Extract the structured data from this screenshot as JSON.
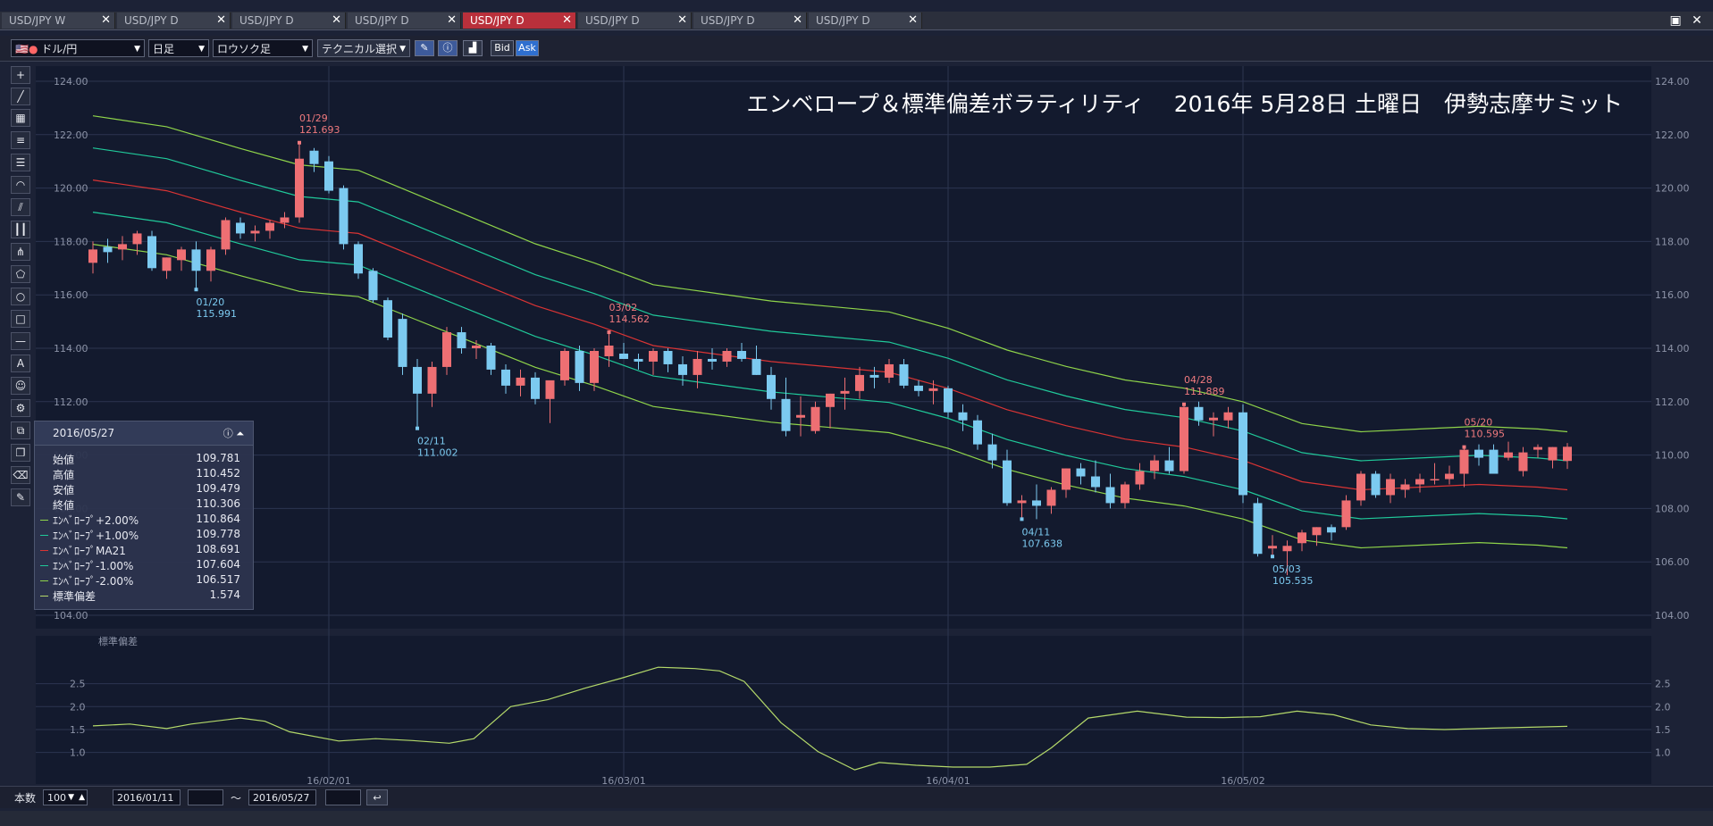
{
  "tabs": [
    {
      "label": "USD/JPY W",
      "active": false
    },
    {
      "label": "USD/JPY D",
      "active": false
    },
    {
      "label": "USD/JPY D",
      "active": false
    },
    {
      "label": "USD/JPY D",
      "active": false
    },
    {
      "label": "USD/JPY D",
      "active": true
    },
    {
      "label": "USD/JPY D",
      "active": false
    },
    {
      "label": "USD/JPY D",
      "active": false
    },
    {
      "label": "USD/JPY D",
      "active": false
    }
  ],
  "toolbar": {
    "pair": "ドル/円",
    "period": "日足",
    "chart_type": "ロウソク足",
    "technical": "テクニカル選択",
    "bid": "Bid",
    "ask": "Ask"
  },
  "bottom": {
    "count_label": "本数",
    "count_value": "100",
    "from_date": "2016/01/11",
    "tilde": "〜",
    "to_date": "2016/05/27"
  },
  "info": {
    "date": "2016/05/27",
    "rows": [
      {
        "label": "始値",
        "value": "109.781",
        "color": ""
      },
      {
        "label": "高値",
        "value": "110.452",
        "color": ""
      },
      {
        "label": "安値",
        "value": "109.479",
        "color": ""
      },
      {
        "label": "終値",
        "value": "110.306",
        "color": ""
      },
      {
        "label": "ｴﾝﾍﾞﾛｰﾌﾟ+2.00%",
        "value": "110.864",
        "color": "#8fd44a"
      },
      {
        "label": "ｴﾝﾍﾞﾛｰﾌﾟ+1.00%",
        "value": "109.778",
        "color": "#20c99a"
      },
      {
        "label": "ｴﾝﾍﾞﾛｰﾌﾟMA21",
        "value": "108.691",
        "color": "#d93434"
      },
      {
        "label": "ｴﾝﾍﾞﾛｰﾌﾟ-1.00%",
        "value": "107.604",
        "color": "#20c99a"
      },
      {
        "label": "ｴﾝﾍﾞﾛｰﾌﾟ-2.00%",
        "value": "106.517",
        "color": "#8fd44a"
      },
      {
        "label": "標準偏差",
        "value": "1.574",
        "color": "#b4d96a"
      }
    ]
  },
  "chart_data": [
    {
      "type": "candlestick",
      "title": "エンベロープ＆標準偏差ボラティリティ　 2016年 5月28日 土曜日　伊勢志摩サミット",
      "ylim": [
        104,
        124
      ],
      "y_ticks": [
        "124.00",
        "122.00",
        "120.00",
        "118.00",
        "116.00",
        "114.00",
        "112.00",
        "110.00",
        "108.00",
        "106.00",
        "104.00"
      ],
      "x_ticks": [
        {
          "label": "16/02/01",
          "index": 16
        },
        {
          "label": "16/03/01",
          "index": 36
        },
        {
          "label": "16/04/01",
          "index": 58
        },
        {
          "label": "16/05/02",
          "index": 78
        }
      ],
      "colors": {
        "up": "#ee6f73",
        "down": "#7ccaf0",
        "ma": "#d93434",
        "env1": "#20c99a",
        "env2": "#8fd44a"
      },
      "candles": [
        [
          117.2,
          118.0,
          116.8,
          117.7
        ],
        [
          117.8,
          118.1,
          117.2,
          117.6
        ],
        [
          117.7,
          118.2,
          117.3,
          117.9
        ],
        [
          117.9,
          118.4,
          117.5,
          118.3
        ],
        [
          118.2,
          118.4,
          116.9,
          117.0
        ],
        [
          116.9,
          117.4,
          116.6,
          117.4
        ],
        [
          117.3,
          117.8,
          116.9,
          117.7
        ],
        [
          117.7,
          118.0,
          116.2,
          116.9
        ],
        [
          116.9,
          117.8,
          116.5,
          117.7
        ],
        [
          117.7,
          118.9,
          117.5,
          118.8
        ],
        [
          118.7,
          118.9,
          118.1,
          118.3
        ],
        [
          118.3,
          118.6,
          118.0,
          118.4
        ],
        [
          118.4,
          118.8,
          118.1,
          118.7
        ],
        [
          118.7,
          119.1,
          118.5,
          118.9
        ],
        [
          118.9,
          121.7,
          118.7,
          121.1
        ],
        [
          121.4,
          121.5,
          120.6,
          120.9
        ],
        [
          121.0,
          121.2,
          119.8,
          119.9
        ],
        [
          120.0,
          120.1,
          117.7,
          117.9
        ],
        [
          117.9,
          118.0,
          116.6,
          116.8
        ],
        [
          116.9,
          117.0,
          115.7,
          115.8
        ],
        [
          115.8,
          115.9,
          114.3,
          114.4
        ],
        [
          115.1,
          115.3,
          113.0,
          113.3
        ],
        [
          113.3,
          113.6,
          111.0,
          112.3
        ],
        [
          112.3,
          113.5,
          111.8,
          113.3
        ],
        [
          113.3,
          114.8,
          113.0,
          114.6
        ],
        [
          114.6,
          114.8,
          113.8,
          114.0
        ],
        [
          114.0,
          114.3,
          113.6,
          114.1
        ],
        [
          114.1,
          114.2,
          113.0,
          113.2
        ],
        [
          113.2,
          113.4,
          112.3,
          112.6
        ],
        [
          112.6,
          113.2,
          112.2,
          112.9
        ],
        [
          112.9,
          113.1,
          111.9,
          112.1
        ],
        [
          112.1,
          112.6,
          111.2,
          112.8
        ],
        [
          112.8,
          114.0,
          112.6,
          113.9
        ],
        [
          113.9,
          114.1,
          112.4,
          112.7
        ],
        [
          112.7,
          114.0,
          112.4,
          113.9
        ],
        [
          113.7,
          114.6,
          113.3,
          114.1
        ],
        [
          113.8,
          114.2,
          113.6,
          113.6
        ],
        [
          113.6,
          113.8,
          113.2,
          113.5
        ],
        [
          113.5,
          114.0,
          113.0,
          113.9
        ],
        [
          113.9,
          114.0,
          113.1,
          113.4
        ],
        [
          113.4,
          113.7,
          112.6,
          113.0
        ],
        [
          113.0,
          113.9,
          112.5,
          113.6
        ],
        [
          113.6,
          114.0,
          113.2,
          113.5
        ],
        [
          113.5,
          114.0,
          113.3,
          113.9
        ],
        [
          113.9,
          114.2,
          113.5,
          113.6
        ],
        [
          113.6,
          114.1,
          113.0,
          113.0
        ],
        [
          113.0,
          113.3,
          111.7,
          112.1
        ],
        [
          112.1,
          112.9,
          110.7,
          110.9
        ],
        [
          111.4,
          112.2,
          110.7,
          111.5
        ],
        [
          110.9,
          112.0,
          110.8,
          111.8
        ],
        [
          111.8,
          112.3,
          111.0,
          112.3
        ],
        [
          112.3,
          112.9,
          111.7,
          112.4
        ],
        [
          112.4,
          113.3,
          112.1,
          113.0
        ],
        [
          113.0,
          113.3,
          112.5,
          112.9
        ],
        [
          112.9,
          113.6,
          112.7,
          113.4
        ],
        [
          113.4,
          113.6,
          112.5,
          112.6
        ],
        [
          112.6,
          112.8,
          112.2,
          112.4
        ],
        [
          112.4,
          112.8,
          111.9,
          112.5
        ],
        [
          112.5,
          112.6,
          111.4,
          111.6
        ],
        [
          111.6,
          111.9,
          110.9,
          111.3
        ],
        [
          111.3,
          111.5,
          110.2,
          110.4
        ],
        [
          110.4,
          110.8,
          109.5,
          109.8
        ],
        [
          109.8,
          110.2,
          108.1,
          108.2
        ],
        [
          108.2,
          108.5,
          107.6,
          108.3
        ],
        [
          108.3,
          108.9,
          107.6,
          108.1
        ],
        [
          108.1,
          108.8,
          107.8,
          108.7
        ],
        [
          108.7,
          109.5,
          108.4,
          109.5
        ],
        [
          109.5,
          109.7,
          108.9,
          109.2
        ],
        [
          109.2,
          109.8,
          108.6,
          108.8
        ],
        [
          108.8,
          109.3,
          108.0,
          108.2
        ],
        [
          108.2,
          109.0,
          108.0,
          108.9
        ],
        [
          108.9,
          109.7,
          108.7,
          109.4
        ],
        [
          109.4,
          110.0,
          109.1,
          109.8
        ],
        [
          109.8,
          110.3,
          109.3,
          109.4
        ],
        [
          109.4,
          111.9,
          109.3,
          111.8
        ],
        [
          111.8,
          112.0,
          111.1,
          111.3
        ],
        [
          111.3,
          111.6,
          110.7,
          111.4
        ],
        [
          111.3,
          111.8,
          111.0,
          111.6
        ],
        [
          111.6,
          111.9,
          108.2,
          108.5
        ],
        [
          108.2,
          108.4,
          106.2,
          106.3
        ],
        [
          106.5,
          107.0,
          106.2,
          106.6
        ],
        [
          106.4,
          106.8,
          105.5,
          106.6
        ],
        [
          106.7,
          107.2,
          106.4,
          107.1
        ],
        [
          107.0,
          107.3,
          106.6,
          107.3
        ],
        [
          107.3,
          107.4,
          106.8,
          107.1
        ],
        [
          107.3,
          108.5,
          107.2,
          108.3
        ],
        [
          108.3,
          109.4,
          108.1,
          109.3
        ],
        [
          109.3,
          109.4,
          108.4,
          108.5
        ],
        [
          108.5,
          109.3,
          108.2,
          109.1
        ],
        [
          108.7,
          109.1,
          108.4,
          108.9
        ],
        [
          108.9,
          109.3,
          108.6,
          109.1
        ],
        [
          109.1,
          109.7,
          108.9,
          109.1
        ],
        [
          109.1,
          109.6,
          108.9,
          109.3
        ],
        [
          109.3,
          110.3,
          108.8,
          110.2
        ],
        [
          110.2,
          110.4,
          109.6,
          109.9
        ],
        [
          110.2,
          110.4,
          109.3,
          109.3
        ],
        [
          109.9,
          110.5,
          109.8,
          110.1
        ],
        [
          109.4,
          110.3,
          109.2,
          110.1
        ],
        [
          110.2,
          110.4,
          109.9,
          110.3
        ],
        [
          109.8,
          110.3,
          109.5,
          110.3
        ],
        [
          109.78,
          110.45,
          109.48,
          110.31
        ]
      ],
      "ma21": [
        [
          0,
          120.3
        ],
        [
          5,
          119.9
        ],
        [
          10,
          119.1
        ],
        [
          14,
          118.5
        ],
        [
          18,
          118.3
        ],
        [
          22,
          117.4
        ],
        [
          26,
          116.5
        ],
        [
          30,
          115.6
        ],
        [
          34,
          114.9
        ],
        [
          38,
          114.1
        ],
        [
          42,
          113.8
        ],
        [
          46,
          113.5
        ],
        [
          50,
          113.3
        ],
        [
          54,
          113.1
        ],
        [
          58,
          112.5
        ],
        [
          62,
          111.7
        ],
        [
          66,
          111.1
        ],
        [
          70,
          110.6
        ],
        [
          74,
          110.3
        ],
        [
          78,
          109.8
        ],
        [
          82,
          109.0
        ],
        [
          86,
          108.7
        ],
        [
          90,
          108.8
        ],
        [
          94,
          108.9
        ],
        [
          98,
          108.8
        ],
        [
          100,
          108.7
        ]
      ],
      "env_offsets_pct": [
        -2,
        -1,
        1,
        2
      ],
      "annotations": [
        {
          "date": "01/29",
          "value": "121.693",
          "index": 14,
          "kind": "high"
        },
        {
          "date": "01/20",
          "value": "115.991",
          "index": 7,
          "kind": "low"
        },
        {
          "date": "02/11",
          "value": "111.002",
          "index": 22,
          "kind": "low"
        },
        {
          "date": "03/02",
          "value": "114.562",
          "index": 35,
          "kind": "high"
        },
        {
          "date": "04/11",
          "value": "107.638",
          "index": 63,
          "kind": "low"
        },
        {
          "date": "04/28",
          "value": "111.889",
          "index": 74,
          "kind": "high"
        },
        {
          "date": "05/03",
          "value": "105.535",
          "index": 80,
          "kind": "low"
        },
        {
          "date": "05/20",
          "value": "110.595",
          "index": 93,
          "kind": "high"
        }
      ]
    },
    {
      "type": "line",
      "title": "標準偏差",
      "ylim": [
        0.7,
        3.0
      ],
      "y_ticks": [
        "2.5",
        "2.0",
        "1.5",
        "1.0"
      ],
      "color": "#b4d96a",
      "values": [
        [
          0,
          1.58
        ],
        [
          3,
          1.62
        ],
        [
          6,
          1.52
        ],
        [
          8,
          1.62
        ],
        [
          12,
          1.75
        ],
        [
          14,
          1.68
        ],
        [
          16,
          1.45
        ],
        [
          20,
          1.25
        ],
        [
          23,
          1.3
        ],
        [
          26,
          1.26
        ],
        [
          29,
          1.2
        ],
        [
          31,
          1.3
        ],
        [
          34,
          2.0
        ],
        [
          37,
          2.15
        ],
        [
          40,
          2.4
        ],
        [
          43,
          2.62
        ],
        [
          46,
          2.86
        ],
        [
          49,
          2.83
        ],
        [
          51,
          2.78
        ],
        [
          53,
          2.55
        ],
        [
          56,
          1.65
        ],
        [
          59,
          1.02
        ],
        [
          62,
          0.62
        ],
        [
          64,
          0.78
        ],
        [
          67,
          0.72
        ],
        [
          70,
          0.68
        ],
        [
          73,
          0.68
        ],
        [
          76,
          0.74
        ],
        [
          78,
          1.1
        ],
        [
          81,
          1.75
        ],
        [
          85,
          1.9
        ],
        [
          89,
          1.77
        ],
        [
          92,
          1.76
        ],
        [
          95,
          1.78
        ],
        [
          98,
          1.9
        ],
        [
          101,
          1.82
        ],
        [
          104,
          1.6
        ],
        [
          107,
          1.52
        ],
        [
          110,
          1.5
        ],
        [
          114,
          1.53
        ],
        [
          117,
          1.55
        ],
        [
          120,
          1.57
        ]
      ]
    }
  ]
}
